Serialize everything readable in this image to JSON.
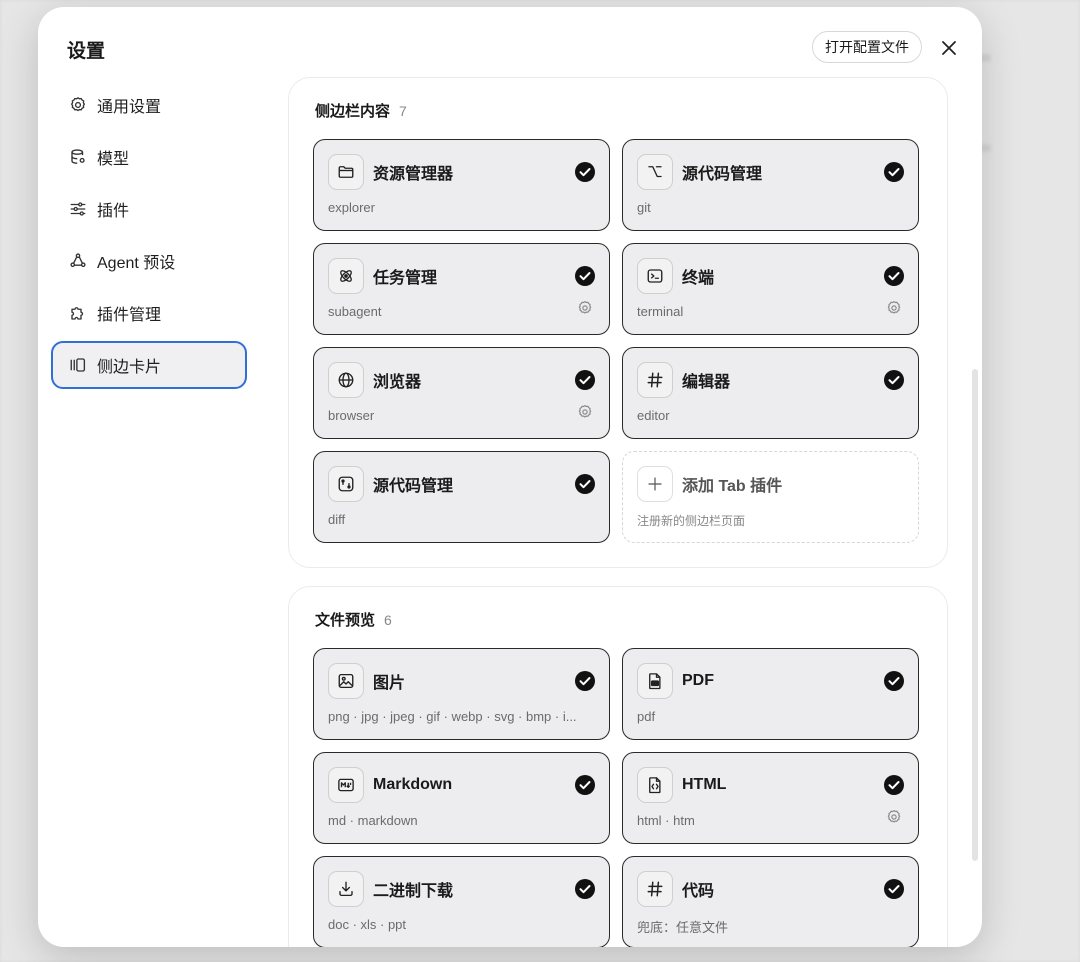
{
  "modal": {
    "title": "设置",
    "open_config_label": "打开配置文件"
  },
  "nav": [
    {
      "label": "通用设置",
      "icon": "gear-icon"
    },
    {
      "label": "模型",
      "icon": "database-icon"
    },
    {
      "label": "插件",
      "icon": "sliders-icon"
    },
    {
      "label": "Agent 预设",
      "icon": "recycle-icon"
    },
    {
      "label": "插件管理",
      "icon": "puzzle-icon"
    },
    {
      "label": "侧边卡片",
      "icon": "side-cards-icon",
      "active": true
    }
  ],
  "sidebar_section": {
    "title": "侧边栏内容",
    "count": "7",
    "cards": [
      {
        "label": "资源管理器",
        "sub": "explorer",
        "icon": "folder-icon",
        "checked": true,
        "gear": false
      },
      {
        "label": "源代码管理",
        "sub": "git",
        "icon": "git-branch-icon",
        "checked": true,
        "gear": false
      },
      {
        "label": "任务管理",
        "sub": "subagent",
        "icon": "atom-icon",
        "checked": true,
        "gear": true
      },
      {
        "label": "终端",
        "sub": "terminal",
        "icon": "terminal-icon",
        "checked": true,
        "gear": true
      },
      {
        "label": "浏览器",
        "sub": "browser",
        "icon": "globe-icon",
        "checked": true,
        "gear": true
      },
      {
        "label": "编辑器",
        "sub": "editor",
        "icon": "hash-icon",
        "checked": true,
        "gear": false
      },
      {
        "label": "源代码管理",
        "sub": "diff",
        "icon": "diff-icon",
        "checked": true,
        "gear": false
      }
    ],
    "add_card": {
      "label": "添加 Tab 插件",
      "sub": "注册新的侧边栏页面"
    }
  },
  "preview_section": {
    "title": "文件预览",
    "count": "6",
    "cards": [
      {
        "label": "图片",
        "sub": "png · jpg · jpeg · gif · webp · svg · bmp · i...",
        "icon": "image-icon",
        "checked": true,
        "gear": false
      },
      {
        "label": "PDF",
        "sub": "pdf",
        "icon": "pdf-file-icon",
        "checked": true,
        "gear": false
      },
      {
        "label": "Markdown",
        "sub": "md · markdown",
        "icon": "markdown-icon",
        "checked": true,
        "gear": false
      },
      {
        "label": "HTML",
        "sub": "html · htm",
        "icon": "html-file-icon",
        "checked": true,
        "gear": true
      },
      {
        "label": "二进制下载",
        "sub": "doc · xls · ppt",
        "icon": "download-icon",
        "checked": true,
        "gear": false
      },
      {
        "label": "代码",
        "sub": "兜底：任意文件",
        "icon": "hash-icon",
        "checked": true,
        "gear": false
      }
    ]
  }
}
